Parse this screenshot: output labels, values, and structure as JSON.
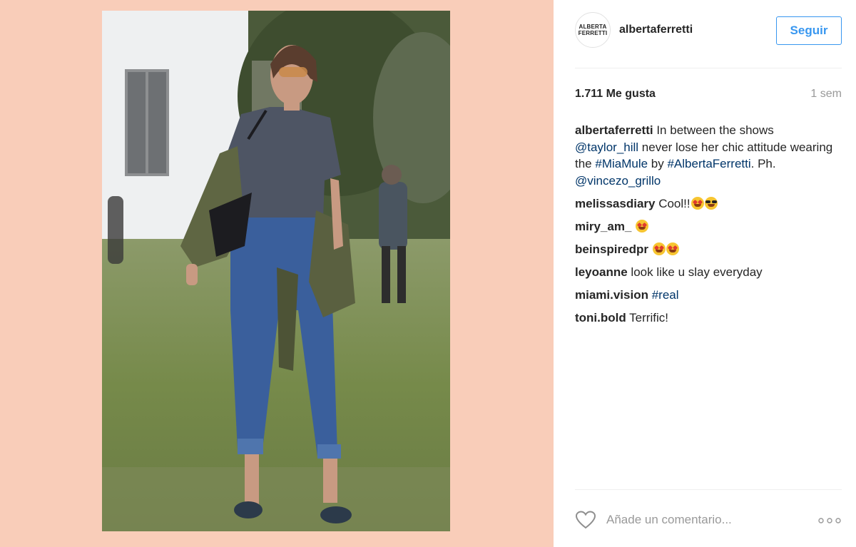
{
  "post": {
    "username": "albertaferretti",
    "avatar_text": [
      "ALBERTA",
      "FERRETTI"
    ],
    "follow_label": "Seguir",
    "likes": "1.711 Me gusta",
    "time": "1 sem",
    "caption": {
      "user": "albertaferretti",
      "text_1": " In between the shows ",
      "mention_1": "@taylor_hill",
      "text_2": " never lose her chic attitude wearing the ",
      "tag_1": "#MiaMule",
      "text_3": " by ",
      "tag_2": "#AlbertaFerretti",
      "text_4": ". Ph. ",
      "mention_2": "@vincezo_grillo"
    },
    "comments": [
      {
        "user": "melissasdiary",
        "text": " Cool!!"
      },
      {
        "user": "miry_am_",
        "text": " "
      },
      {
        "user": "beinspiredpr",
        "text": " "
      },
      {
        "user": "leyoanne",
        "text": " look like u slay everyday"
      },
      {
        "user": "miami.vision",
        "text": " ",
        "tag": "#real"
      },
      {
        "user": "toni.bold",
        "text": " Terrific!"
      }
    ],
    "comment_placeholder": "Añade un comentario...",
    "icons": {
      "like": "heart-outline-icon",
      "more": "more-dots-icon"
    },
    "colors": {
      "background": "#f9cdb9",
      "accent": "#3897f0",
      "link": "#003569"
    }
  }
}
